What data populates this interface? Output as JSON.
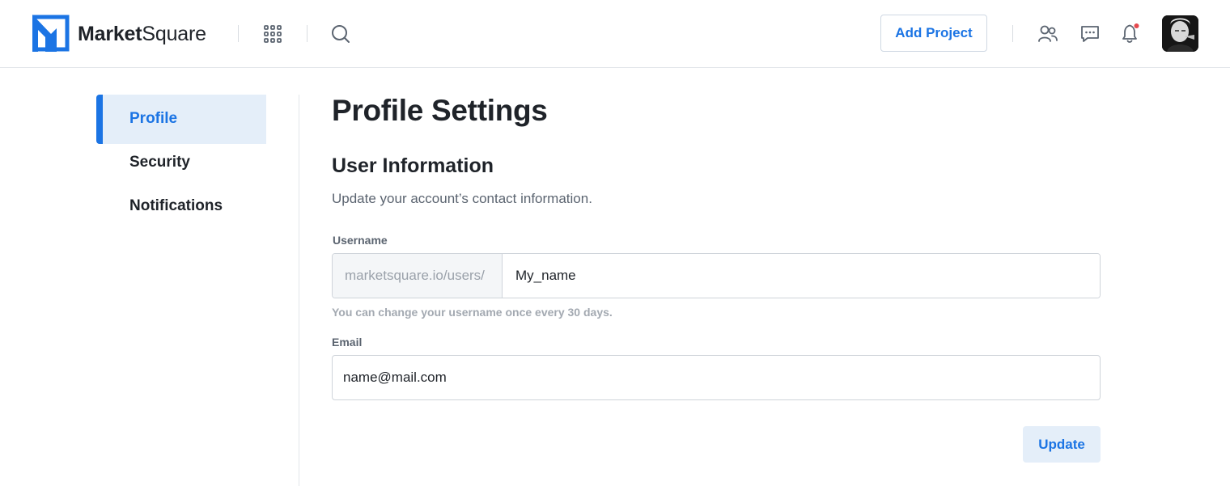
{
  "brand": {
    "part1": "Market",
    "part2": "Square"
  },
  "header": {
    "icons": [
      "apps-grid-icon",
      "search-icon",
      "users-icon",
      "chat-icon",
      "bell-icon"
    ],
    "add_project_label": "Add Project",
    "notification_dot_color": "#e5484d"
  },
  "sidebar": {
    "items": [
      {
        "label": "Profile",
        "active": true
      },
      {
        "label": "Security",
        "active": false
      },
      {
        "label": "Notifications",
        "active": false
      }
    ]
  },
  "main": {
    "title": "Profile Settings",
    "section_title": "User Information",
    "section_desc": "Update your account’s contact information.",
    "username": {
      "label": "Username",
      "prefix": "marketsquare.io/users/",
      "value": "My_name",
      "help": "You can change your username once every 30 days."
    },
    "email": {
      "label": "Email",
      "value": "name@mail.com"
    },
    "update_label": "Update"
  },
  "colors": {
    "accent": "#1b74e4",
    "accent_light": "#e4eef9",
    "text": "#1f2329",
    "muted": "#5b6470"
  }
}
